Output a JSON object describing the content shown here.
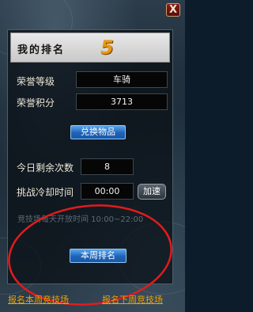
{
  "window": {
    "close_glyph": "X"
  },
  "header": {
    "title": "我的排名",
    "rank": "5"
  },
  "honor": {
    "level_label": "荣誉等级",
    "level_value": "车骑",
    "points_label": "荣誉积分",
    "points_value": "3713"
  },
  "exchange_button": "兑换物品",
  "challenges": {
    "remaining_label": "今日剩余次数",
    "remaining_value": "8",
    "cooldown_label": "挑战冷却时间",
    "cooldown_value": "00:00",
    "speed_button": "加速"
  },
  "schedule_text": "竞技场每天开放时间 10:00~22:00",
  "weekly_rank_button": "本周排名",
  "links": {
    "signup_this_week": "报名本周竞技场",
    "signup_next_week": "报名下周竞技场"
  },
  "colors": {
    "rank_orange": "#e69a12",
    "button_blue": "#1e62b8",
    "link_orange": "#f0a000",
    "annotation_red": "#e31b1b"
  }
}
